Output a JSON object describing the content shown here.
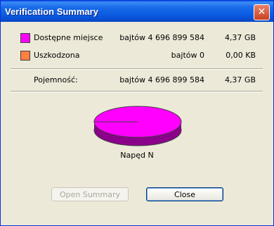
{
  "window": {
    "title": "Verification Summary",
    "close_glyph": "✕"
  },
  "rows": [
    {
      "label": "Dostępne miejsce",
      "bytes": "bajtów 4 696 899 584",
      "size": "4,37 GB",
      "color": "#FF00FF"
    },
    {
      "label": "Uszkodzona",
      "bytes": "bajtów 0",
      "size": "0,00 KB",
      "color": "#FF8040"
    }
  ],
  "capacity": {
    "label": "Pojemność:",
    "bytes": "bajtów 4 696 899 584",
    "size": "4,37 GB"
  },
  "drive": {
    "label": "Napęd N",
    "used_fraction": 0.0,
    "pie_color": "#FF00FF",
    "pie_side_color": "#8B008B"
  },
  "buttons": {
    "open_summary": "Open Summary",
    "close": "Close"
  }
}
